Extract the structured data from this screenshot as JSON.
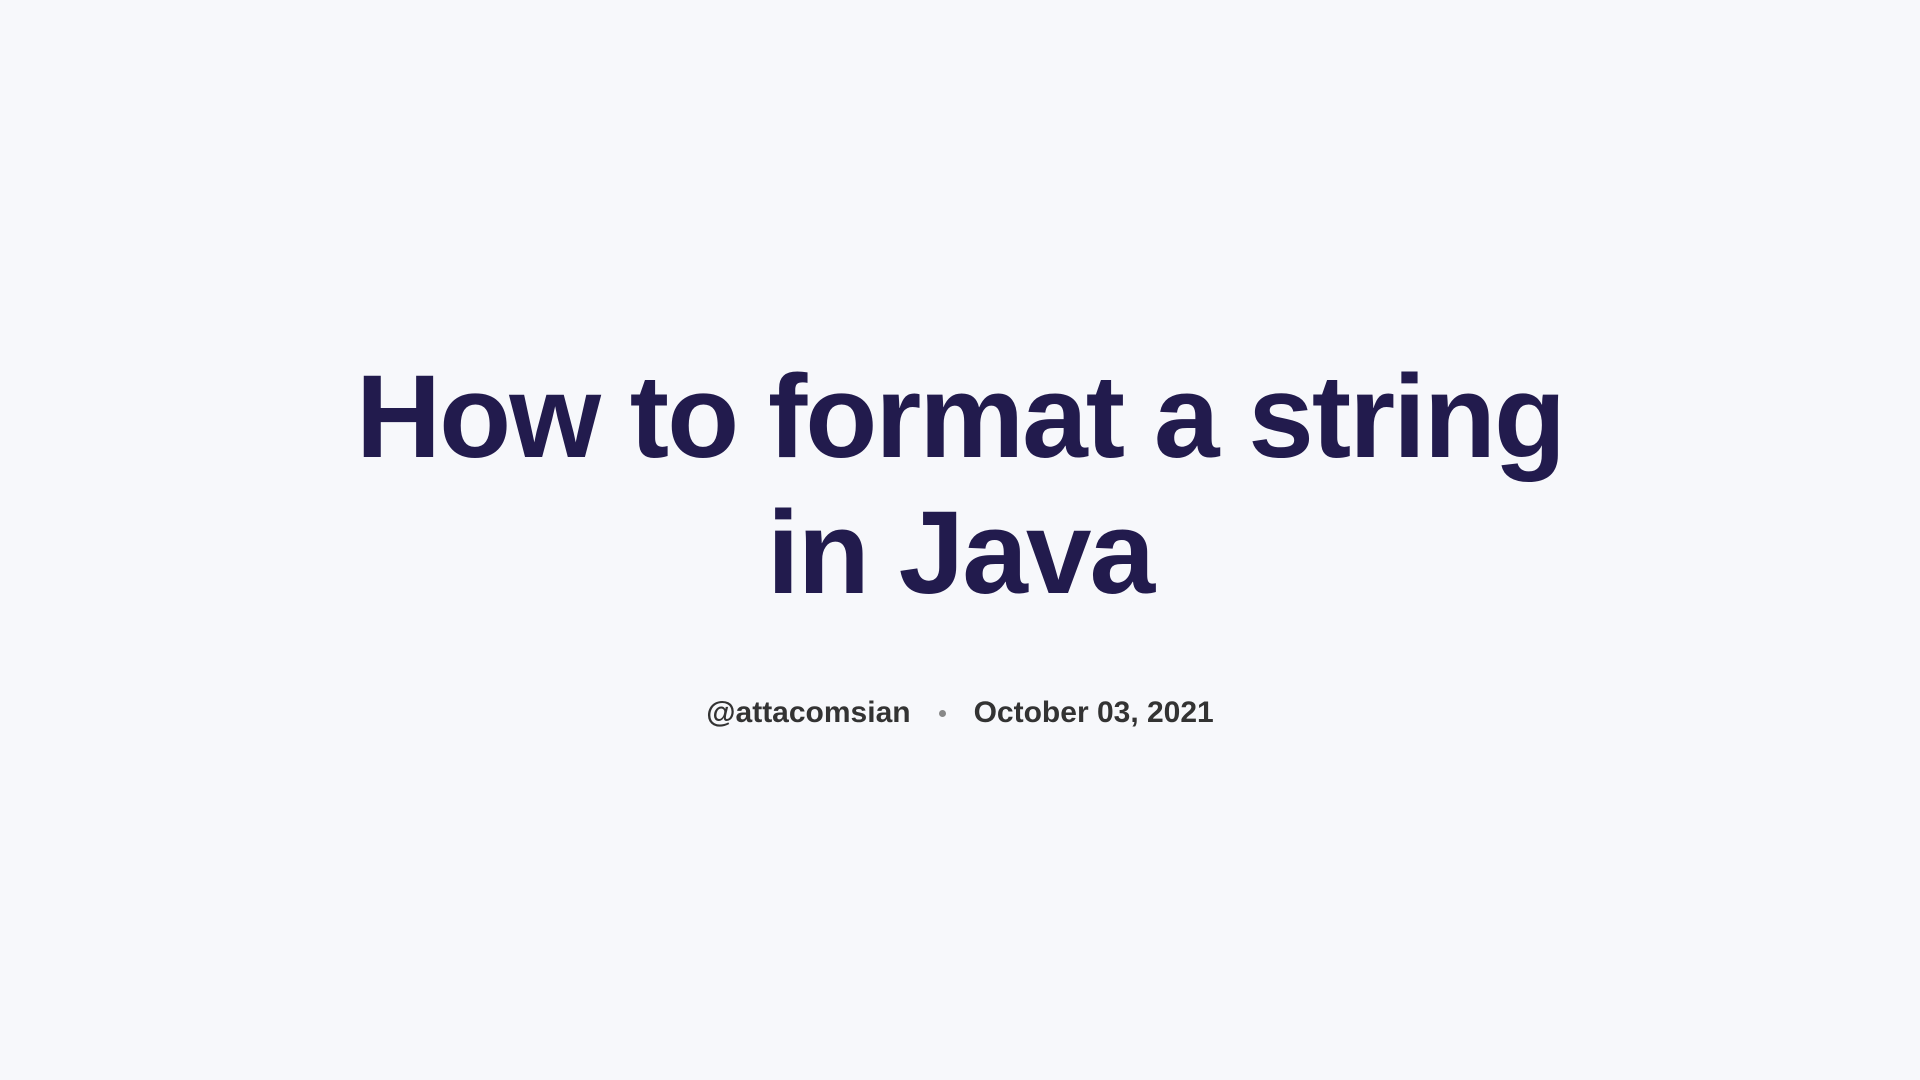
{
  "article": {
    "title": "How to format a string in Java",
    "author": "@attacomsian",
    "date": "October 03, 2021"
  }
}
